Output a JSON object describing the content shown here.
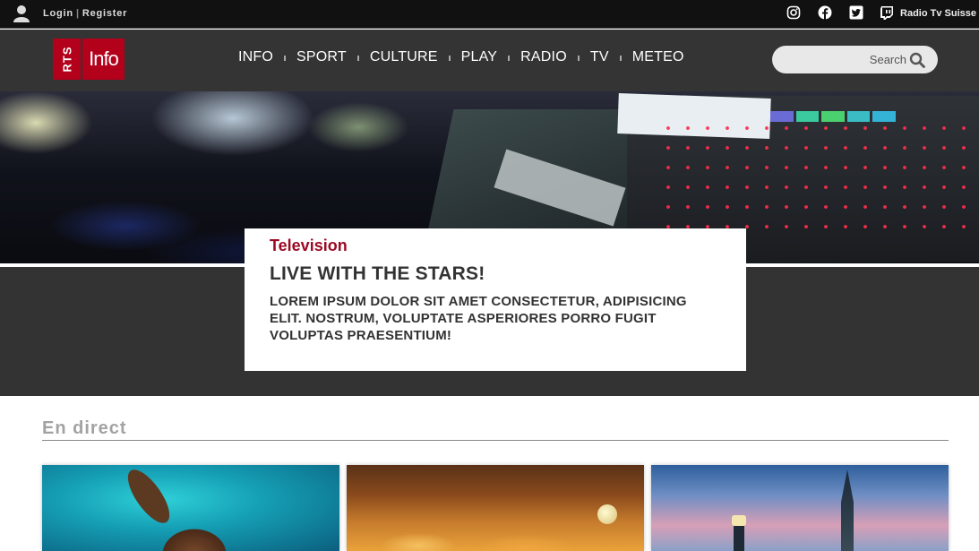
{
  "topbar": {
    "login_label": "Login",
    "separator": "|",
    "register_label": "Register",
    "social": [
      "instagram-icon",
      "facebook-icon",
      "twitter-icon",
      "twitch-icon"
    ],
    "brand_name": "Radio Tv Suisse"
  },
  "header": {
    "logo": {
      "left": "RTS",
      "right": "Info"
    },
    "nav": [
      "INFO",
      "SPORT",
      "CULTURE",
      "PLAY",
      "RADIO",
      "TV",
      "METEO"
    ],
    "search": {
      "placeholder": "Search"
    }
  },
  "feature": {
    "category": "Television",
    "title": "LIVE WITH THE STARS!",
    "description": "LOREM IPSUM DOLOR SIT AMET CONSECTETUR, ADIPISICING ELIT. NOSTRUM, VOLUPTATE ASPERIORES PORRO FUGIT VOLUPTAS PRAESENTIUM!"
  },
  "live": {
    "title": "En direct"
  },
  "colors": {
    "brand_red": "#b3001b",
    "category_red": "#9b0a24",
    "header_bg": "#343434",
    "topbar_bg": "#111111"
  }
}
